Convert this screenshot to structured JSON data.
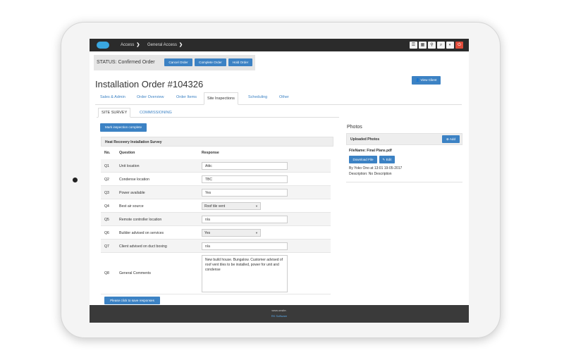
{
  "topbar": {
    "crumbs": [
      "Access",
      "General Access"
    ],
    "icons": [
      "menu-icon",
      "grid-icon",
      "pin-icon",
      "search-icon",
      "contrast-icon",
      "power-icon"
    ]
  },
  "status": {
    "label": "STATUS: Confirmed Order",
    "buttons": [
      "Cancel Order",
      "Complete Order",
      "Hold Order"
    ]
  },
  "order": {
    "title": "Installation Order #104326",
    "view_client": "View Client"
  },
  "tabs": [
    "Sales & Admin",
    "Order Overview",
    "Order Items",
    "Site Inspections",
    "Scheduling",
    "Other"
  ],
  "subtabs": [
    "SITE SURVEY",
    "COMMISSIONING"
  ],
  "mark_complete": "Mark inspection complete",
  "survey": {
    "title": "Heat Recovery Installation Survey",
    "headers": [
      "No.",
      "Question",
      "Response"
    ],
    "rows": [
      {
        "no": "Q1",
        "question": "Unit location",
        "response": "Attic",
        "kind": "input"
      },
      {
        "no": "Q2",
        "question": "Condense location",
        "response": "TBC",
        "kind": "input"
      },
      {
        "no": "Q3",
        "question": "Power available",
        "response": "Yes",
        "kind": "input"
      },
      {
        "no": "Q4",
        "question": "Best air source",
        "response": "Roof tile vent",
        "kind": "select"
      },
      {
        "no": "Q5",
        "question": "Remote controller location",
        "response": "n/a",
        "kind": "input"
      },
      {
        "no": "Q6",
        "question": "Builder advised on services",
        "response": "Yes",
        "kind": "select"
      },
      {
        "no": "Q7",
        "question": "Client advised on duct boxing",
        "response": "n/a",
        "kind": "input"
      },
      {
        "no": "Q8",
        "question": "General Comments",
        "response": "New build house. Bungalow. Customer advised of roof vent tiles to be installed, power for unit and condense",
        "kind": "textarea"
      }
    ],
    "save_label": "Please click to save responses"
  },
  "photos": {
    "section_title": "Photos",
    "panel_title": "Uploaded Photos",
    "add_label": "Add",
    "file_name": "FileName: Final Plans.pdf",
    "download_label": "Download File",
    "edit_label": "Edit",
    "uploaded_by": "By Yoko Ono at 13:01 19-05-2017",
    "description": "Description: No Description"
  },
  "footer": {
    "line1": "www.onsite.",
    "line2": "RK Software"
  },
  "colors": {
    "accent": "#3c82c4",
    "topbar": "#2b2b2b",
    "power": "#e04b3a",
    "footer": "#3a3a3a"
  }
}
